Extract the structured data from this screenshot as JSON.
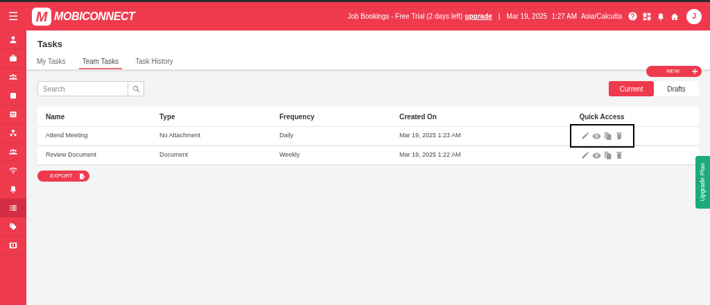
{
  "header": {
    "menu_glyph": "☰",
    "logo_letter": "M",
    "brand": "MOBICONNECT",
    "trial_text": "Job Bookings - Free Trial (2 days left)",
    "upgrade_link": "upgrade",
    "separator": "|",
    "date": "Mar 19, 2025",
    "time": "1:27 AM",
    "timezone": "Asia/Calcutta",
    "avatar_initial": "J"
  },
  "sidebar": {
    "items": [
      {
        "kind": "user",
        "selected": false
      },
      {
        "kind": "briefcase",
        "selected": false
      },
      {
        "kind": "group",
        "selected": false
      },
      {
        "kind": "square",
        "selected": false
      },
      {
        "kind": "news",
        "selected": false
      },
      {
        "kind": "radiation",
        "selected": false
      },
      {
        "kind": "group",
        "selected": false
      },
      {
        "kind": "wifi",
        "selected": false
      },
      {
        "kind": "bell",
        "selected": false
      },
      {
        "kind": "list",
        "selected": true
      },
      {
        "kind": "tag",
        "selected": false
      },
      {
        "kind": "media",
        "selected": false
      }
    ]
  },
  "page_title": "Tasks",
  "tabs": [
    {
      "label": "My Tasks",
      "selected": false
    },
    {
      "label": "Team Tasks",
      "selected": true
    },
    {
      "label": "Task History",
      "selected": false
    }
  ],
  "new_button": "NEW",
  "search": {
    "placeholder": "Search"
  },
  "view_toggle": [
    {
      "label": "Current",
      "selected": true
    },
    {
      "label": "Drafts",
      "selected": false
    }
  ],
  "table": {
    "columns": [
      "Name",
      "Type",
      "Frequency",
      "Created On",
      "Quick Access"
    ],
    "rows": [
      {
        "cells": [
          "Attend Meeting",
          "No Attachment",
          "Daily",
          "Mar 19, 2025 1:23 AM"
        ],
        "highlighted": true
      },
      {
        "cells": [
          "Review Document",
          "Document",
          "Weekly",
          "Mar 19, 2025 1:22 AM"
        ],
        "highlighted": false
      }
    ]
  },
  "export_button": "EXPORT",
  "upgrade_tab": "Upgrade Plan"
}
